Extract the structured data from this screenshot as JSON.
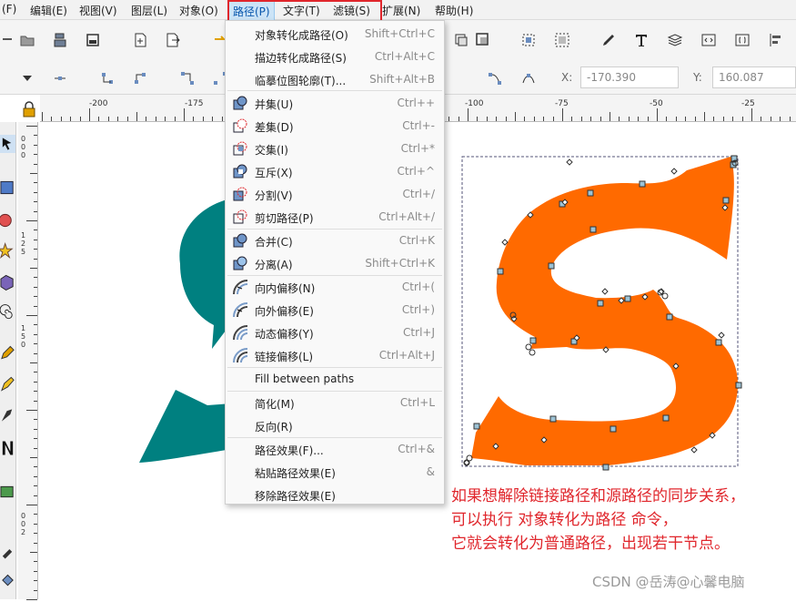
{
  "menubar": {
    "items": [
      "(F)",
      "编辑(E)",
      "视图(V)",
      "图层(L)",
      "对象(O)",
      "路径(P)",
      "文字(T)",
      "滤镜(S)",
      "扩展(N)",
      "帮助(H)"
    ]
  },
  "coords": {
    "x_label": "X:",
    "x_value": "-170.390",
    "y_label": "Y:",
    "y_value": "160.087"
  },
  "ruler": {
    "labels": [
      "-200",
      "-175",
      "-100",
      "-75",
      "-50",
      "-25"
    ]
  },
  "vruler": {
    "labels": [
      "0\n0\n0",
      "1\n2\n5",
      "1\n5\n0",
      "0\n0\n2"
    ]
  },
  "path_menu": {
    "items": [
      {
        "label": "对象转化成路径(O)",
        "shortcut": "Shift+Ctrl+C",
        "icon": "none"
      },
      {
        "label": "描边转化成路径(S)",
        "shortcut": "Ctrl+Alt+C",
        "icon": "none"
      },
      {
        "label": "临摹位图轮廓(T)...",
        "shortcut": "Shift+Alt+B",
        "icon": "none"
      },
      {
        "label": "并集(U)",
        "shortcut": "Ctrl++",
        "icon": "union-icon"
      },
      {
        "label": "差集(D)",
        "shortcut": "Ctrl+-",
        "icon": "difference-icon"
      },
      {
        "label": "交集(I)",
        "shortcut": "Ctrl+*",
        "icon": "intersection-icon"
      },
      {
        "label": "互斥(X)",
        "shortcut": "Ctrl+^",
        "icon": "exclusion-icon"
      },
      {
        "label": "分割(V)",
        "shortcut": "Ctrl+/",
        "icon": "division-icon"
      },
      {
        "label": "剪切路径(P)",
        "shortcut": "Ctrl+Alt+/",
        "icon": "cut-path-icon"
      },
      {
        "label": "合并(C)",
        "shortcut": "Ctrl+K",
        "icon": "combine-icon"
      },
      {
        "label": "分离(A)",
        "shortcut": "Shift+Ctrl+K",
        "icon": "break-apart-icon"
      },
      {
        "label": "向内偏移(N)",
        "shortcut": "Ctrl+(",
        "icon": "inset-icon"
      },
      {
        "label": "向外偏移(E)",
        "shortcut": "Ctrl+)",
        "icon": "outset-icon"
      },
      {
        "label": "动态偏移(Y)",
        "shortcut": "Ctrl+J",
        "icon": "dynamic-offset-icon"
      },
      {
        "label": "链接偏移(L)",
        "shortcut": "Ctrl+Alt+J",
        "icon": "linked-offset-icon"
      },
      {
        "label": "Fill between paths",
        "shortcut": "",
        "icon": "none"
      },
      {
        "label": "简化(M)",
        "shortcut": "Ctrl+L",
        "icon": "none"
      },
      {
        "label": "反向(R)",
        "shortcut": "",
        "icon": "none"
      },
      {
        "label": "路径效果(F)...",
        "shortcut": "Ctrl+&",
        "icon": "none"
      },
      {
        "label": "粘贴路径效果(E)",
        "shortcut": "&",
        "icon": "none"
      },
      {
        "label": "移除路径效果(E)",
        "shortcut": "",
        "icon": "none"
      }
    ]
  },
  "annotation": {
    "lines": [
      "如果想解除链接路径和源路径的同步关系，",
      "可以执行 对象转化为路径 命令，",
      "它就会转化为普通路径，出现若干节点。"
    ]
  },
  "watermark": "CSDN @岳涛@心馨电脑",
  "colors": {
    "highlight_border": "#e0262c",
    "shape_orange": "#ff6a00",
    "shape_teal": "#008080",
    "annotation_text": "#e0262c"
  }
}
